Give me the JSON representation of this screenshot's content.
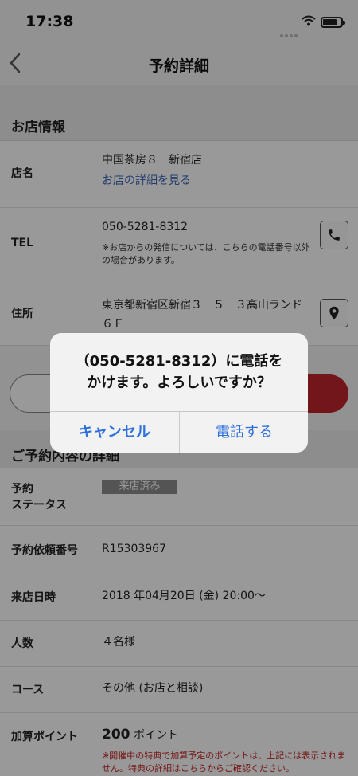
{
  "status_bar": {
    "time": "17:38"
  },
  "nav": {
    "title": "予約詳細"
  },
  "store_section": {
    "title": "お店情報",
    "rows": [
      {
        "label": "店名",
        "value": "中国茶房８　新宿店",
        "link": "お店の詳細を見る"
      },
      {
        "label": "TEL",
        "value": "050-5281-8312",
        "note": "※お店からの発信については、こちらの電話番号以外の場合があります。"
      },
      {
        "label": "住所",
        "value": "東京都新宿区新宿３－５－３高山ランド６Ｆ"
      }
    ]
  },
  "reservation_section": {
    "title": "ご予約内容の詳細",
    "rows": [
      {
        "label": "予約\nステータス",
        "badge": "来店済み"
      },
      {
        "label": "予約依頼番号",
        "value": "R15303967"
      },
      {
        "label": "来店日時",
        "value": "2018 年04月20日 (金)  20:00～"
      },
      {
        "label": "人数",
        "value": "４名様"
      },
      {
        "label": "コース",
        "value": "その他 (お店と相談)"
      }
    ],
    "points": {
      "label": "加算ポイント",
      "number": "200",
      "unit": "ポイント",
      "note": "※開催中の特典で加算予定のポイントは、上記には表示されません。特典の詳細はこちらからご確認ください。"
    }
  },
  "dialog": {
    "message": "（050-5281-8312）に電話を\nかけます。よろしいですか？",
    "cancel_label": "キャンセル",
    "confirm_label": "電話する"
  },
  "colors": {
    "accent_red": "#c0262c",
    "link_blue": "#3d66b8",
    "dialog_blue": "#2f6fde"
  },
  "icons": [
    "back-chevron-icon",
    "phone-icon",
    "location-pin-icon",
    "wifi-icon",
    "battery-icon"
  ]
}
